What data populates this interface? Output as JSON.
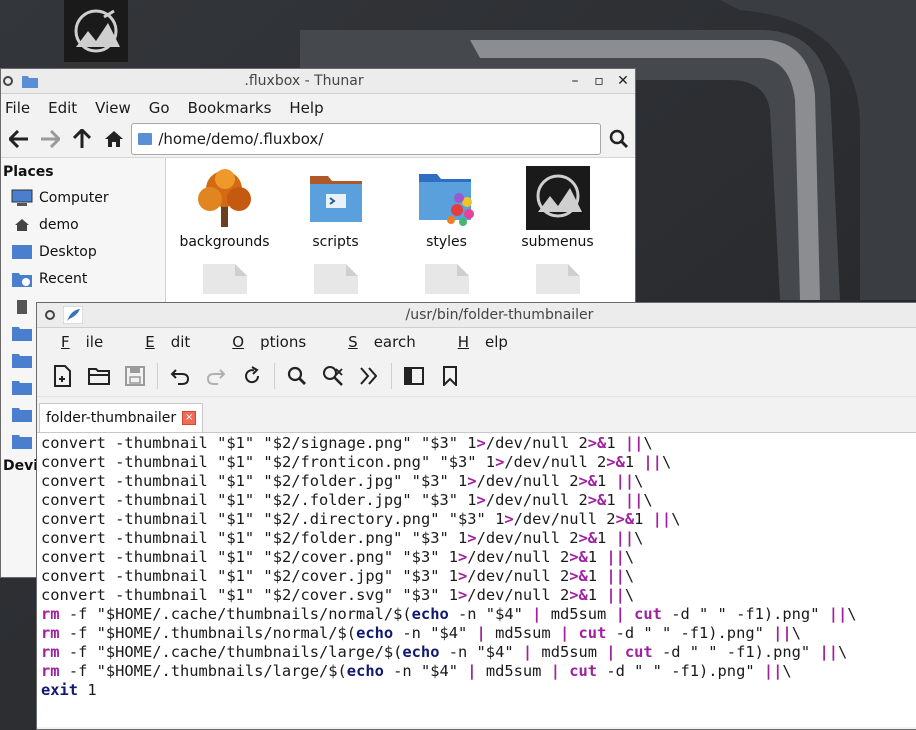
{
  "colors": {
    "wallpaper_dark": "#2a2d31",
    "wallpaper_mid": "#4b4e53",
    "folder_blue": "#5b8fd4",
    "tab_close_red": "#ee6c56",
    "syntax_keyword_purple": "#a020a0",
    "syntax_builtin_navy": "#101870"
  },
  "thunar": {
    "title": ".fluxbox - Thunar",
    "menu": [
      "File",
      "Edit",
      "View",
      "Go",
      "Bookmarks",
      "Help"
    ],
    "location": "/home/demo/.fluxbox/",
    "sidebar": {
      "places_heading": "Places",
      "items": [
        {
          "label": "Computer",
          "icon": "computer-icon"
        },
        {
          "label": "demo",
          "icon": "home-icon"
        },
        {
          "label": "Desktop",
          "icon": "desktop-icon"
        },
        {
          "label": "Recent",
          "icon": "recent-folder-icon"
        }
      ],
      "devices_heading_partial": "Devi"
    },
    "files": [
      {
        "name": "backgrounds",
        "icon": "tree-image-icon"
      },
      {
        "name": "scripts",
        "icon": "scripts-folder-icon"
      },
      {
        "name": "styles",
        "icon": "palette-folder-icon"
      },
      {
        "name": "submenus",
        "icon": "fluxbox-logo-icon"
      }
    ]
  },
  "editor": {
    "title": "/usr/bin/folder-thumbnailer",
    "menu": [
      "File",
      "Edit",
      "Options",
      "Search",
      "Help"
    ],
    "tab_label": "folder-thumbnailer",
    "tab_close": "×",
    "code_lines": [
      [
        [
          "convert",
          "n"
        ],
        [
          " -",
          "n"
        ],
        [
          "thumbnail",
          "n"
        ],
        [
          " \"$1\" \"$2/signage.png\" \"$3\" 1",
          "n"
        ],
        [
          ">",
          "k"
        ],
        [
          "/dev/null 2",
          "n"
        ],
        [
          ">&",
          "k"
        ],
        [
          "1 ",
          "n"
        ],
        [
          "||",
          "k"
        ],
        [
          "\\",
          "n"
        ]
      ],
      [
        [
          "convert",
          "n"
        ],
        [
          " -",
          "n"
        ],
        [
          "thumbnail",
          "n"
        ],
        [
          " \"$1\" \"$2/fronticon.png\" \"$3\" 1",
          "n"
        ],
        [
          ">",
          "k"
        ],
        [
          "/dev/null 2",
          "n"
        ],
        [
          ">&",
          "k"
        ],
        [
          "1 ",
          "n"
        ],
        [
          "||",
          "k"
        ],
        [
          "\\",
          "n"
        ]
      ],
      [
        [
          "convert",
          "n"
        ],
        [
          " -",
          "n"
        ],
        [
          "thumbnail",
          "n"
        ],
        [
          " \"$1\" \"$2/folder.jpg\" \"$3\" 1",
          "n"
        ],
        [
          ">",
          "k"
        ],
        [
          "/dev/null 2",
          "n"
        ],
        [
          ">&",
          "k"
        ],
        [
          "1 ",
          "n"
        ],
        [
          "||",
          "k"
        ],
        [
          "\\",
          "n"
        ]
      ],
      [
        [
          "convert",
          "n"
        ],
        [
          " -",
          "n"
        ],
        [
          "thumbnail",
          "n"
        ],
        [
          " \"$1\" \"$2/.folder.jpg\" \"$3\" 1",
          "n"
        ],
        [
          ">",
          "k"
        ],
        [
          "/dev/null 2",
          "n"
        ],
        [
          ">&",
          "k"
        ],
        [
          "1 ",
          "n"
        ],
        [
          "||",
          "k"
        ],
        [
          "\\",
          "n"
        ]
      ],
      [
        [
          "convert",
          "n"
        ],
        [
          " -",
          "n"
        ],
        [
          "thumbnail",
          "n"
        ],
        [
          " \"$1\" \"$2/.directory.png\" \"$3\" 1",
          "n"
        ],
        [
          ">",
          "k"
        ],
        [
          "/dev/null 2",
          "n"
        ],
        [
          ">&",
          "k"
        ],
        [
          "1 ",
          "n"
        ],
        [
          "||",
          "k"
        ],
        [
          "\\",
          "n"
        ]
      ],
      [
        [
          "convert",
          "n"
        ],
        [
          " -",
          "n"
        ],
        [
          "thumbnail",
          "n"
        ],
        [
          " \"$1\" \"$2/folder.png\" \"$3\" 1",
          "n"
        ],
        [
          ">",
          "k"
        ],
        [
          "/dev/null 2",
          "n"
        ],
        [
          ">&",
          "k"
        ],
        [
          "1 ",
          "n"
        ],
        [
          "||",
          "k"
        ],
        [
          "\\",
          "n"
        ]
      ],
      [
        [
          "convert",
          "n"
        ],
        [
          " -",
          "n"
        ],
        [
          "thumbnail",
          "n"
        ],
        [
          " \"$1\" \"$2/cover.png\" \"$3\" 1",
          "n"
        ],
        [
          ">",
          "k"
        ],
        [
          "/dev/null 2",
          "n"
        ],
        [
          ">&",
          "k"
        ],
        [
          "1 ",
          "n"
        ],
        [
          "||",
          "k"
        ],
        [
          "\\",
          "n"
        ]
      ],
      [
        [
          "convert",
          "n"
        ],
        [
          " -",
          "n"
        ],
        [
          "thumbnail",
          "n"
        ],
        [
          " \"$1\" \"$2/cover.jpg\" \"$3\" 1",
          "n"
        ],
        [
          ">",
          "k"
        ],
        [
          "/dev/null 2",
          "n"
        ],
        [
          ">&",
          "k"
        ],
        [
          "1 ",
          "n"
        ],
        [
          "||",
          "k"
        ],
        [
          "\\",
          "n"
        ]
      ],
      [
        [
          "convert",
          "n"
        ],
        [
          " -",
          "n"
        ],
        [
          "thumbnail",
          "n"
        ],
        [
          " \"$1\" \"$2/cover.svg\" \"$3\" 1",
          "n"
        ],
        [
          ">",
          "k"
        ],
        [
          "/dev/null 2",
          "n"
        ],
        [
          ">&",
          "k"
        ],
        [
          "1 ",
          "n"
        ],
        [
          "||",
          "k"
        ],
        [
          "\\",
          "n"
        ]
      ],
      [
        [
          "rm",
          "k"
        ],
        [
          " -f \"$HOME/.cache/thumbnails/normal/$(",
          "n"
        ],
        [
          "echo",
          "b"
        ],
        [
          " -n \"$4\" ",
          "n"
        ],
        [
          "|",
          "k"
        ],
        [
          " md5sum ",
          "n"
        ],
        [
          "|",
          "k"
        ],
        [
          " ",
          "n"
        ],
        [
          "cut",
          "k"
        ],
        [
          " -d \" \" -f1).png\" ",
          "n"
        ],
        [
          "||",
          "k"
        ],
        [
          "\\",
          "n"
        ]
      ],
      [
        [
          "rm",
          "k"
        ],
        [
          " -f \"$HOME/.thumbnails/normal/$(",
          "n"
        ],
        [
          "echo",
          "b"
        ],
        [
          " -n \"$4\" ",
          "n"
        ],
        [
          "|",
          "k"
        ],
        [
          " md5sum ",
          "n"
        ],
        [
          "|",
          "k"
        ],
        [
          " ",
          "n"
        ],
        [
          "cut",
          "k"
        ],
        [
          " -d \" \" -f1).png\" ",
          "n"
        ],
        [
          "||",
          "k"
        ],
        [
          "\\",
          "n"
        ]
      ],
      [
        [
          "rm",
          "k"
        ],
        [
          " -f \"$HOME/.cache/thumbnails/large/$(",
          "n"
        ],
        [
          "echo",
          "b"
        ],
        [
          " -n \"$4\" ",
          "n"
        ],
        [
          "|",
          "k"
        ],
        [
          " md5sum ",
          "n"
        ],
        [
          "|",
          "k"
        ],
        [
          " ",
          "n"
        ],
        [
          "cut",
          "k"
        ],
        [
          " -d \" \" -f1).png\" ",
          "n"
        ],
        [
          "||",
          "k"
        ],
        [
          "\\",
          "n"
        ]
      ],
      [
        [
          "rm",
          "k"
        ],
        [
          " -f \"$HOME/.thumbnails/large/$(",
          "n"
        ],
        [
          "echo",
          "b"
        ],
        [
          " -n \"$4\" ",
          "n"
        ],
        [
          "|",
          "k"
        ],
        [
          " md5sum ",
          "n"
        ],
        [
          "|",
          "k"
        ],
        [
          " ",
          "n"
        ],
        [
          "cut",
          "k"
        ],
        [
          " -d \" \" -f1).png\" ",
          "n"
        ],
        [
          "||",
          "k"
        ],
        [
          "\\",
          "n"
        ]
      ],
      [
        [
          "exit",
          "b"
        ],
        [
          " 1",
          "n"
        ]
      ]
    ]
  }
}
